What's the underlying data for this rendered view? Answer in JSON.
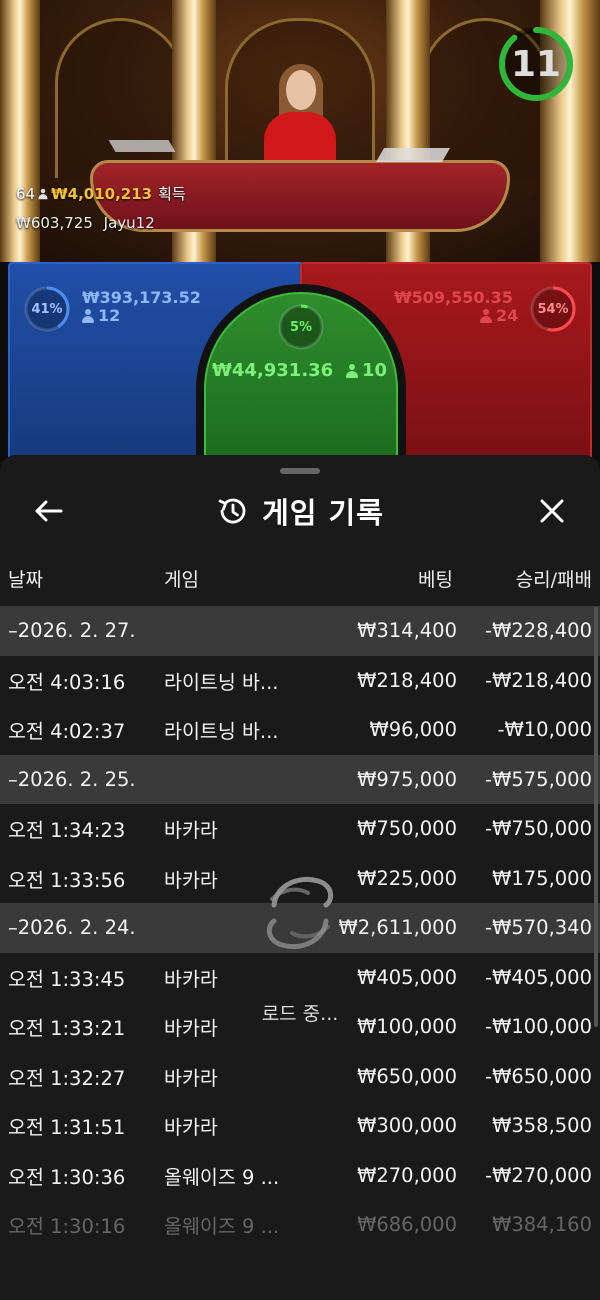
{
  "game": {
    "timer": "11",
    "timer_color": "#2fb73a",
    "winners": {
      "count": "64",
      "amount": "₩4,010,213",
      "label": "획득"
    },
    "last_winner": {
      "amount": "₩603,725",
      "name": "Jayu12"
    }
  },
  "bets": {
    "player": {
      "percent": "41%",
      "percent_value": 0.41,
      "stake": "₩393,173.52",
      "players": "12",
      "color": "#2f62c4"
    },
    "tie": {
      "percent": "5%",
      "percent_value": 0.05,
      "stake": "₩44,931.36",
      "players": "10",
      "color": "#3dbb3a"
    },
    "banker": {
      "percent": "54%",
      "percent_value": 0.54,
      "stake": "₩509,550.35",
      "players": "24",
      "color": "#c02a2a"
    }
  },
  "history": {
    "title": "게임 기록",
    "back_icon": "arrow-left-icon",
    "close_icon": "close-icon",
    "title_icon": "history-clock-icon",
    "columns": {
      "date": "날짜",
      "game": "게임",
      "bet": "베팅",
      "winloss": "승리/패배"
    },
    "rows": [
      {
        "type": "date",
        "c1": "–2026. 2. 27.",
        "c2": "",
        "c3": "₩314,400",
        "c4": "-₩228,400"
      },
      {
        "type": "item",
        "c1": "오전 4:03:16",
        "c2": "라이트닝 바...",
        "c3": "₩218,400",
        "c4": "-₩218,400"
      },
      {
        "type": "item",
        "c1": "오전 4:02:37",
        "c2": "라이트닝 바...",
        "c3": "₩96,000",
        "c4": "-₩10,000"
      },
      {
        "type": "date",
        "c1": "–2026. 2. 25.",
        "c2": "",
        "c3": "₩975,000",
        "c4": "-₩575,000"
      },
      {
        "type": "item",
        "c1": "오전 1:34:23",
        "c2": "바카라",
        "c3": "₩750,000",
        "c4": "-₩750,000"
      },
      {
        "type": "item",
        "c1": "오전 1:33:56",
        "c2": "바카라",
        "c3": "₩225,000",
        "c4": "₩175,000"
      },
      {
        "type": "date",
        "c1": "–2026. 2. 24.",
        "c2": "",
        "c3": "₩2,611,000",
        "c4": "-₩570,340"
      },
      {
        "type": "item",
        "c1": "오전 1:33:45",
        "c2": "바카라",
        "c3": "₩405,000",
        "c4": "-₩405,000"
      },
      {
        "type": "item",
        "c1": "오전 1:33:21",
        "c2": "바카라",
        "c3": "₩100,000",
        "c4": "-₩100,000"
      },
      {
        "type": "item",
        "c1": "오전 1:32:27",
        "c2": "바카라",
        "c3": "₩650,000",
        "c4": "-₩650,000"
      },
      {
        "type": "item",
        "c1": "오전 1:31:51",
        "c2": "바카라",
        "c3": "₩300,000",
        "c4": "₩358,500"
      },
      {
        "type": "item",
        "c1": "오전 1:30:36",
        "c2": "올웨이즈 9 ...",
        "c3": "₩270,000",
        "c4": "-₩270,000"
      },
      {
        "type": "fade",
        "c1": "오전 1:30:16",
        "c2": "올웨이즈 9 ...",
        "c3": "₩686,000",
        "c4": "₩384,160"
      }
    ],
    "loading": "로드 중..."
  }
}
